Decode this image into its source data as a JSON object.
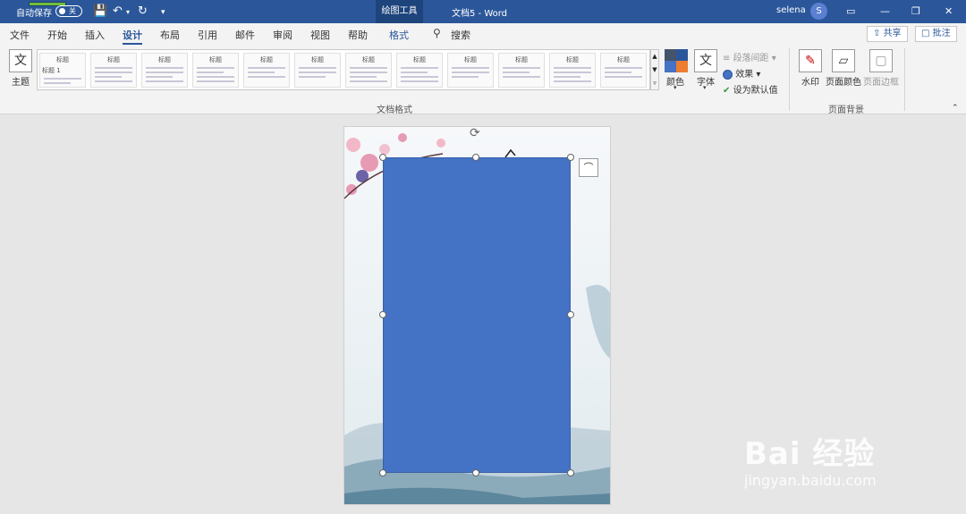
{
  "titlebar": {
    "autosave_label": "自动保存",
    "autosave_state": "关",
    "context_tab": "绘图工具",
    "doc_title": "文档5  -  Word",
    "user_name": "selena",
    "user_initial": "S"
  },
  "tabs": {
    "items": [
      "文件",
      "开始",
      "插入",
      "设计",
      "布局",
      "引用",
      "邮件",
      "审阅",
      "视图",
      "帮助",
      "格式"
    ],
    "active": "设计",
    "search": "搜索",
    "share": "共享",
    "comment": "批注"
  },
  "ribbon": {
    "theme_label": "主题",
    "thumb_titles": [
      "标题",
      "标题",
      "标题",
      "标题",
      "标题",
      "标题",
      "标题",
      "标题",
      "标题",
      "标题",
      "标题",
      "标题"
    ],
    "thumb_heading1": "标题 1",
    "colors_label": "颜色",
    "fonts_label": "字体",
    "fonts_glyph": "文",
    "paragraph_spacing": "段落间距",
    "effects": "效果",
    "set_default": "设为默认值",
    "doc_format_group": "文档格式",
    "watermark": "水印",
    "page_color": "页面颜色",
    "page_borders": "页面边框",
    "page_bg_group": "页面背景",
    "swatch_colors": [
      "#44546a",
      "#2b579a",
      "#4472c4",
      "#ed7d31"
    ]
  },
  "canvas": {
    "shape_fill": "#4472c4"
  },
  "watermark": {
    "brand_text": "Bai 经验",
    "url": "jingyan.baidu.com"
  }
}
